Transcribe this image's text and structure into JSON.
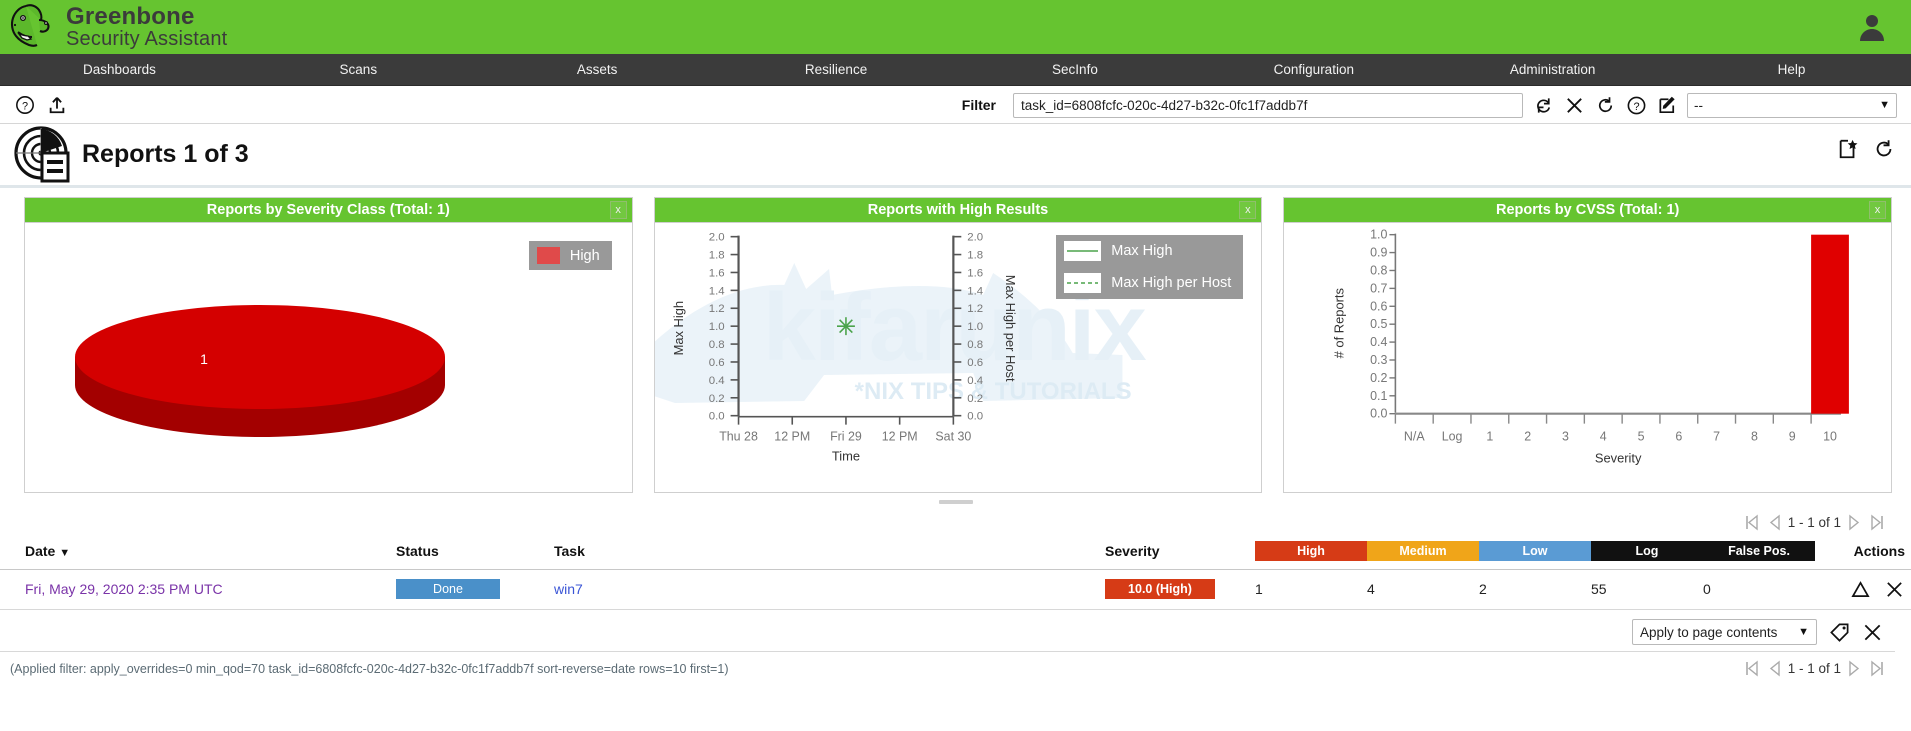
{
  "brand": {
    "line1": "Greenbone",
    "line2": "Security Assistant",
    "bar_color": "#66c430",
    "logo_icon": "dragon-head-logo",
    "user_icon": "user-account-icon"
  },
  "nav": {
    "items": [
      {
        "label": "Dashboards",
        "name": "nav-dashboards"
      },
      {
        "label": "Scans",
        "name": "nav-scans"
      },
      {
        "label": "Assets",
        "name": "nav-assets"
      },
      {
        "label": "Resilience",
        "name": "nav-resilience"
      },
      {
        "label": "SecInfo",
        "name": "nav-secinfo"
      },
      {
        "label": "Configuration",
        "name": "nav-configuration"
      },
      {
        "label": "Administration",
        "name": "nav-administration"
      },
      {
        "label": "Help",
        "name": "nav-help"
      }
    ]
  },
  "filterbar": {
    "help_icon": "help-question-icon",
    "upload_icon": "upload-import-icon",
    "label": "Filter",
    "value": "task_id=6808fcfc-020c-4d27-b32c-0fc1f7addb7f",
    "placeholder": "",
    "icons": [
      {
        "name": "refresh-filter-icon",
        "glyph": "refresh"
      },
      {
        "name": "reset-filter-icon",
        "glyph": "x"
      },
      {
        "name": "restore-default-filter-icon",
        "glyph": "undo"
      },
      {
        "name": "filter-help-icon",
        "glyph": "question"
      },
      {
        "name": "edit-filter-icon",
        "glyph": "edit"
      }
    ],
    "saved_filter_value": "--"
  },
  "page": {
    "title": "Reports 1 of 3",
    "title_icon": "report-radar-icon",
    "actions": [
      {
        "name": "new-report-icon",
        "glyph": "new-star"
      },
      {
        "name": "refresh-page-icon",
        "glyph": "refresh"
      }
    ]
  },
  "dashboard": {
    "close_label": "x",
    "panels": [
      {
        "title": "Reports by Severity Class (Total: 1)",
        "name": "panel-severity-class"
      },
      {
        "title": "Reports with High Results",
        "name": "panel-high-results"
      },
      {
        "title": "Reports by CVSS (Total: 1)",
        "name": "panel-cvss"
      }
    ]
  },
  "chart_data": [
    {
      "type": "pie",
      "title": "Reports by Severity Class (Total: 1)",
      "labels": [
        "High"
      ],
      "values": [
        1
      ],
      "colors": [
        "#d40000"
      ],
      "data_labels": [
        "1"
      ],
      "legend": [
        "High"
      ],
      "legend_position": "top-right",
      "total": 1
    },
    {
      "type": "scatter",
      "title": "Reports with High Results",
      "xlabel": "Time",
      "ylabel": "Max High",
      "y2label": "Max High per Host",
      "xticks": [
        "Thu 28",
        "12 PM",
        "Fri 29",
        "12 PM",
        "Sat 30"
      ],
      "yticks": [
        "0.0",
        "0.2",
        "0.4",
        "0.6",
        "0.8",
        "1.0",
        "1.2",
        "1.4",
        "1.6",
        "1.8",
        "2.0"
      ],
      "y2ticks": [
        "0.0",
        "0.2",
        "0.4",
        "0.6",
        "0.8",
        "1.0",
        "1.2",
        "1.4",
        "1.6",
        "1.8",
        "2.0"
      ],
      "ylim": [
        0.0,
        2.0
      ],
      "grid": false,
      "legend_position": "top-right",
      "series": [
        {
          "name": "Max High",
          "style": "solid",
          "color": "#4ba34b",
          "points": [
            {
              "x": "Fri 29",
              "y": 1.0
            }
          ]
        },
        {
          "name": "Max High per Host",
          "style": "dashed",
          "color": "#4ba34b",
          "points": [
            {
              "x": "Fri 29",
              "y": 1.0
            }
          ]
        }
      ]
    },
    {
      "type": "bar",
      "title": "Reports by CVSS (Total: 1)",
      "xlabel": "Severity",
      "ylabel": "# of Reports",
      "categories": [
        "N/A",
        "Log",
        "1",
        "2",
        "3",
        "4",
        "5",
        "6",
        "7",
        "8",
        "9",
        "10"
      ],
      "values": [
        0,
        0,
        0,
        0,
        0,
        0,
        0,
        0,
        0,
        0,
        0,
        1
      ],
      "yticks": [
        "0.0",
        "0.1",
        "0.2",
        "0.3",
        "0.4",
        "0.5",
        "0.6",
        "0.7",
        "0.8",
        "0.9",
        "1.0"
      ],
      "ylim": [
        0.0,
        1.0
      ],
      "bar_color": "#e00000",
      "grid": false,
      "total": 1
    }
  ],
  "watermark": {
    "main": "kifarunix",
    "sub": "*NIX TIPS & TUTORIALS"
  },
  "pagination_top": {
    "text": "1 - 1 of 1",
    "first_icon": "first-page-icon",
    "prev_icon": "previous-page-icon",
    "next_icon": "next-page-icon",
    "last_icon": "last-page-icon"
  },
  "pagination_bottom": {
    "text": "1 - 1 of 1"
  },
  "table": {
    "headers": {
      "date": "Date",
      "date_sort": "▼",
      "status": "Status",
      "task": "Task",
      "severity": "Severity",
      "high": "High",
      "medium": "Medium",
      "low": "Low",
      "log": "Log",
      "false_pos": "False Pos.",
      "actions": "Actions"
    },
    "rows": [
      {
        "date": "Fri, May 29, 2020 2:35 PM UTC",
        "status": "Done",
        "task": "win7",
        "severity": "10.0 (High)",
        "high": "1",
        "medium": "4",
        "low": "2",
        "log": "55",
        "false_pos": "0",
        "actions": [
          {
            "name": "delta-report-icon",
            "glyph": "delta"
          },
          {
            "name": "delete-report-icon",
            "glyph": "x"
          }
        ]
      }
    ]
  },
  "bottom_controls": {
    "apply_select_value": "Apply to page contents",
    "tag_icon": "add-tag-icon",
    "delete_icon": "delete-selected-icon"
  },
  "footer": {
    "applied_filter": "(Applied filter: apply_overrides=0 min_qod=70 task_id=6808fcfc-020c-4d27-b32c-0fc1f7addb7f sort-reverse=date rows=10 first=1)"
  },
  "colors": {
    "brand_green": "#66c430",
    "nav_dark": "#3b3b3b",
    "high": "#d63b16",
    "medium": "#f0a519",
    "low": "#5a9bd4",
    "log": "#111111",
    "done": "#4a90c9",
    "link": "#3a55d6",
    "visited_link": "#7a33a8"
  }
}
